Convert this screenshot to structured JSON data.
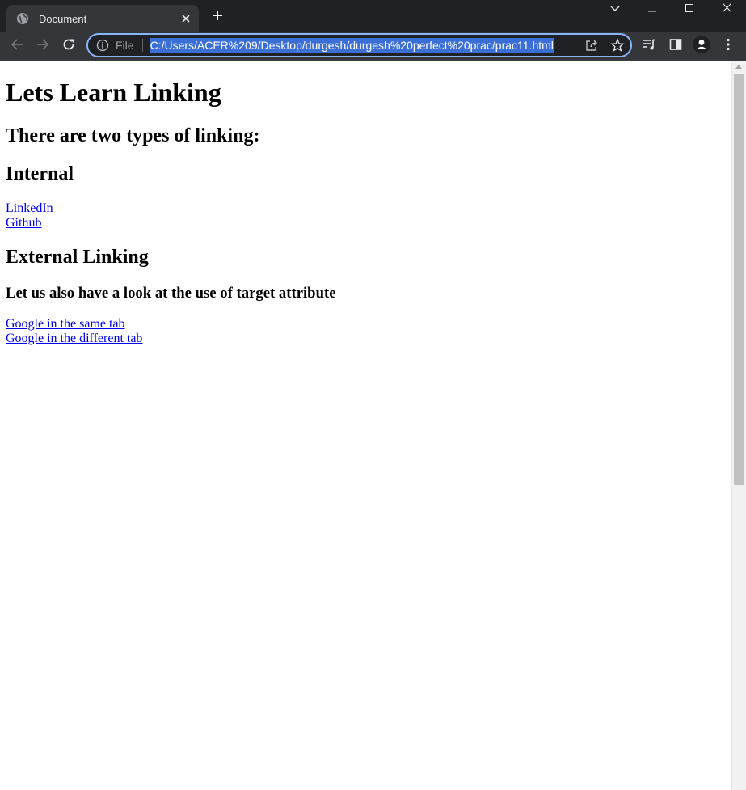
{
  "browser": {
    "tab": {
      "title": "Document"
    },
    "address_bar": {
      "scheme_label": "File",
      "url": "C:/Users/ACER%209/Desktop/durgesh/durgesh%20perfect%20prac/prac11.html"
    }
  },
  "page": {
    "heading": "Lets Learn Linking",
    "subheading": "There are two types of linking:",
    "internal_heading": "Internal",
    "internal_links": [
      "LinkedIn",
      "Github"
    ],
    "external_heading": "External Linking",
    "target_heading": "Let us also have a look at the use of target attribute",
    "target_links": [
      "Google in the same tab",
      "Google in the different tab"
    ]
  },
  "colors": {
    "tabstrip": "#202124",
    "toolbar": "#35363a",
    "omnibox_focus": "#8ab4f8",
    "url_selection": "#3b6fd6",
    "link": "#0000ee"
  },
  "icons": {
    "tab_favicon": "globe-icon",
    "tab_close": "close-icon",
    "new_tab": "plus-icon",
    "back": "arrow-left-icon",
    "forward": "arrow-right-icon",
    "reload": "reload-icon",
    "site_info": "info-icon",
    "share": "share-icon",
    "bookmark": "star-icon",
    "media": "media-queue-icon",
    "side_panel": "side-panel-icon",
    "profile": "profile-icon",
    "menu": "kebab-menu-icon"
  }
}
